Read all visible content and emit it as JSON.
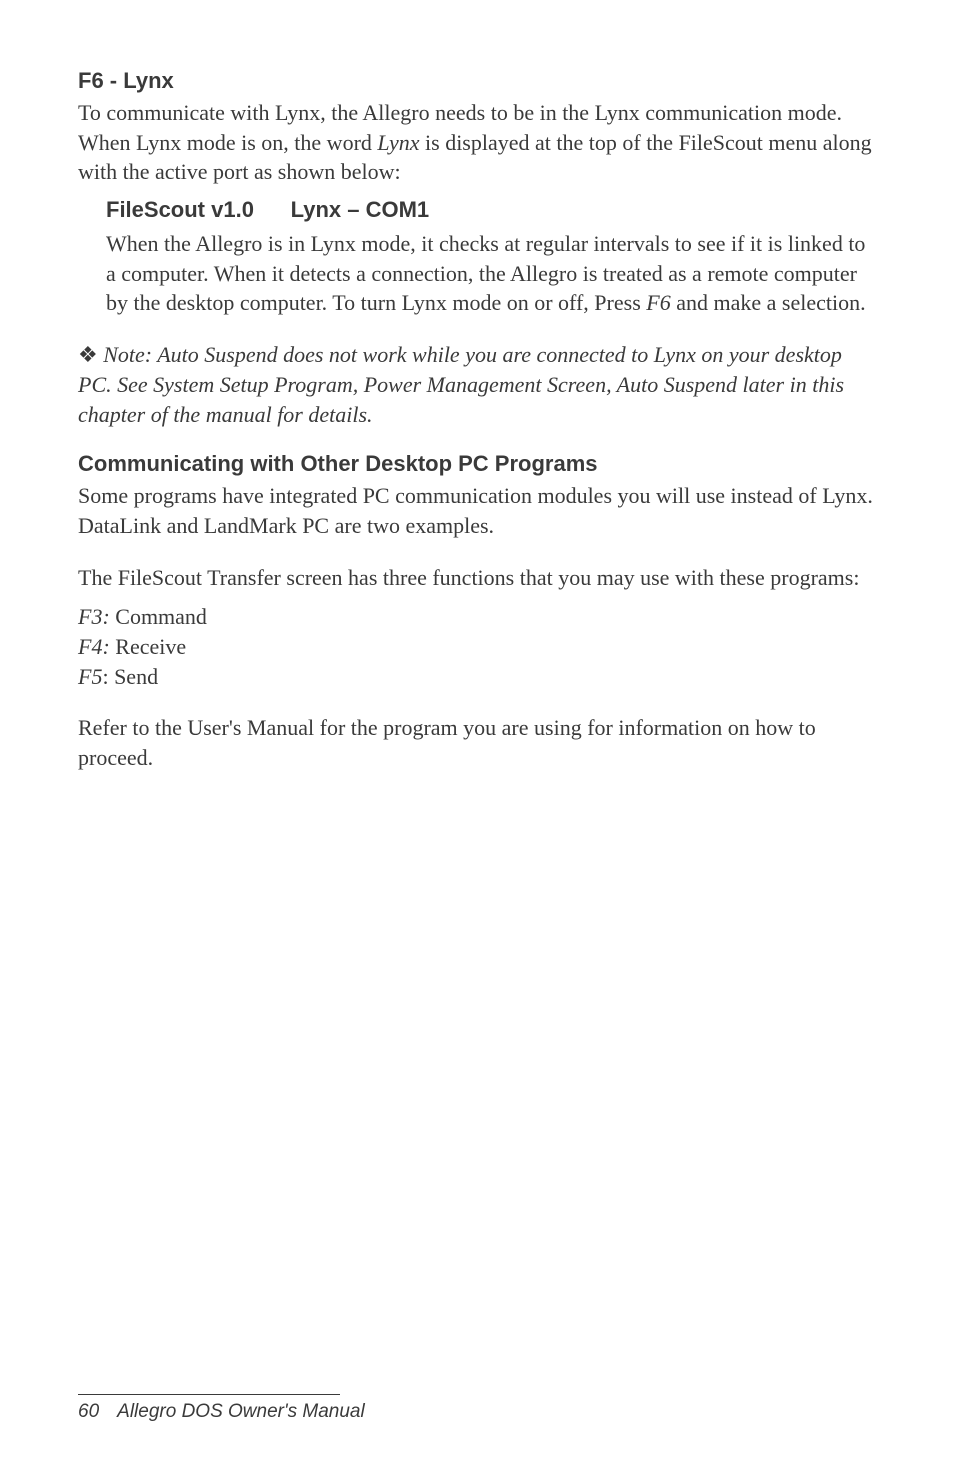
{
  "section1": {
    "heading": "F6 - Lynx",
    "para": "To communicate with Lynx, the Allegro needs to be in the Lynx communication mode. When Lynx mode is on, the word ",
    "para_italic": "Lynx",
    "para_after": " is displayed at the top of the FileScout menu along with the active port as shown below:",
    "subheading": "FileScout v1.0      Lynx – COM1",
    "indent_para_1": "When the Allegro is in Lynx mode, it checks at regular intervals to see if it is linked to a computer. When it detects a connection, the Allegro is treated as a remote computer by the desktop computer. To turn Lynx mode on or off, Press ",
    "indent_para_italic": "F6",
    "indent_para_2": " and make a selection."
  },
  "note": {
    "symbol": "❖",
    "text": " Note: Auto Suspend does not work while you are connected to Lynx on your desktop PC. See System Setup Program, Power Management Screen, Auto Suspend later in this chapter of the manual for details."
  },
  "section2": {
    "heading": "Communicating with Other Desktop PC Programs",
    "para1": "Some programs have integrated PC communication modules you will use instead of Lynx. DataLink and LandMark PC are two examples.",
    "para2": "The FileScout Transfer screen has three functions that you may use with these programs:",
    "list": [
      {
        "key": "F3:",
        "label": " Command"
      },
      {
        "key": "F4:",
        "label": " Receive"
      },
      {
        "key": "F5",
        "label": ": Send"
      }
    ],
    "para3": "Refer to the User's Manual for the program you are using for information on how to proceed."
  },
  "footer": {
    "page": "60",
    "title": "Allegro DOS Owner's Manual"
  }
}
